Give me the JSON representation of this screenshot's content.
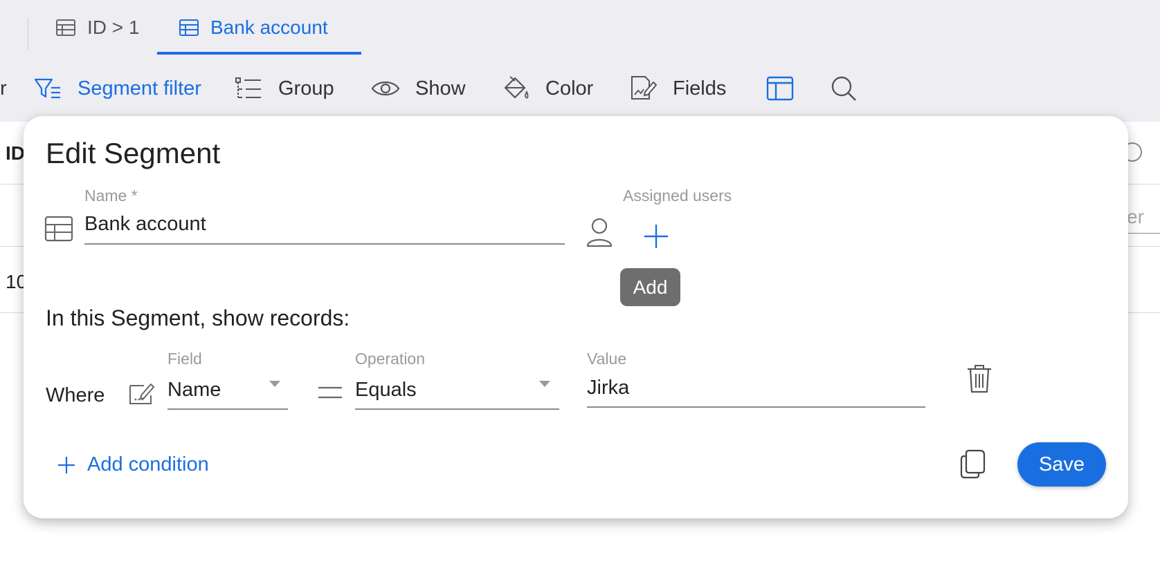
{
  "tabs": [
    {
      "label": "ID > 1",
      "icon": "table-icon",
      "active": false
    },
    {
      "label": "Bank account",
      "icon": "table-icon",
      "active": true
    }
  ],
  "toolbar": {
    "partial_label": "r",
    "segment_filter": "Segment filter",
    "group": "Group",
    "show": "Show",
    "color": "Color",
    "fields": "Fields"
  },
  "background": {
    "header_cut": "ID",
    "filter_cut": "er",
    "row_cut": "10"
  },
  "dialog": {
    "title": "Edit Segment",
    "name_label": "Name *",
    "name_value": "Bank account",
    "assigned_users_label": "Assigned users",
    "add_tooltip": "Add",
    "records_heading": "In this Segment, show records:",
    "condition": {
      "where": "Where",
      "field_label": "Field",
      "field_value": "Name",
      "operation_label": "Operation",
      "operation_value": "Equals",
      "value_label": "Value",
      "value_value": "Jirka"
    },
    "add_condition": "Add condition",
    "save": "Save"
  },
  "colors": {
    "accent": "#1a6fe0",
    "tooltip_bg": "#6e6e6e",
    "toolbar_bg": "#ededf2"
  }
}
